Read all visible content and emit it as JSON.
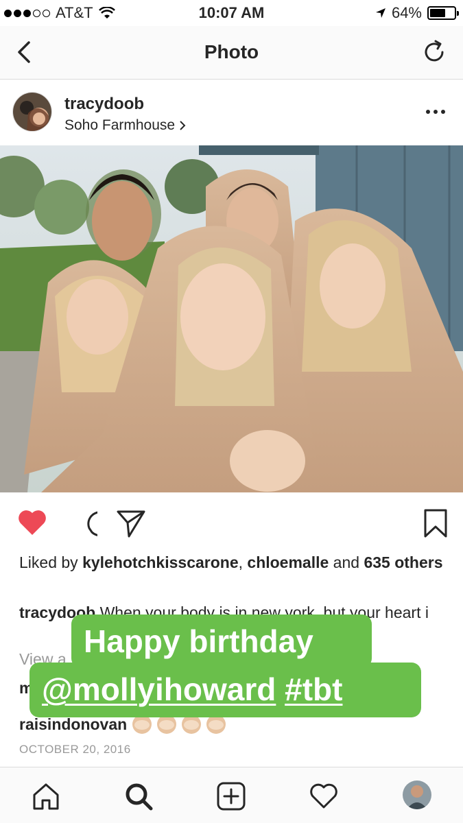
{
  "status_bar": {
    "carrier": "AT&T",
    "time": "10:07 AM",
    "battery": "64%",
    "battery_level": 0.64
  },
  "nav": {
    "title": "Photo"
  },
  "post": {
    "username": "tracydoob",
    "location": "Soho Farmhouse",
    "likes_prefix": "Liked by ",
    "liked_user1": "kylehotchkisscarone",
    "liked_sep": ", ",
    "liked_user2": "chloemalle",
    "likes_and": " and ",
    "likes_others": "635 others",
    "caption_user": "tracydoob",
    "caption_text": " When your body is in new york, but your heart i",
    "view_all": "View a",
    "comment1_user": "m",
    "comment2_user": "raisindonovan",
    "date": "OCTOBER 20, 2016"
  },
  "sticker": {
    "line1": "Happy birthday",
    "mention": "@mollyihoward",
    "hashtag": "#tbt",
    "color": "#6abf4b"
  },
  "colors": {
    "heart": "#ed4956",
    "text": "#262626",
    "muted": "#999999"
  }
}
